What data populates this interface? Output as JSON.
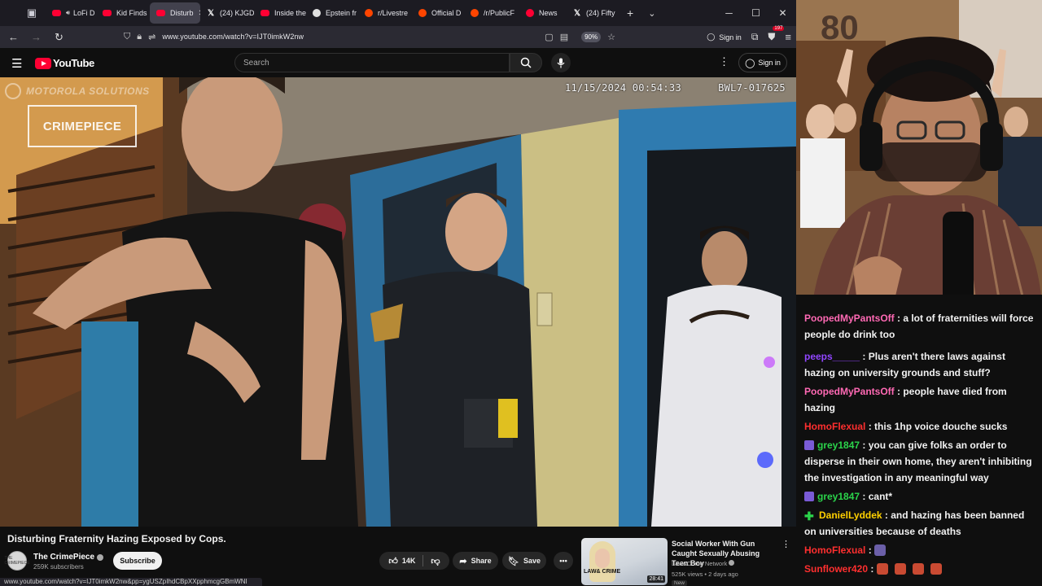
{
  "browser": {
    "tabs": [
      {
        "label": "LoFi D",
        "icon": "youtube",
        "audio": true,
        "active": false
      },
      {
        "label": "Kid Finds",
        "icon": "youtube",
        "active": false
      },
      {
        "label": "Disturb",
        "icon": "youtube",
        "active": true
      },
      {
        "label": "(24) KJGD",
        "icon": "x",
        "active": false
      },
      {
        "label": "Inside the",
        "icon": "youtube",
        "active": false
      },
      {
        "label": "Epstein fr",
        "icon": "epstein",
        "active": false
      },
      {
        "label": "r/Livestre",
        "icon": "reddit",
        "active": false
      },
      {
        "label": "Official D",
        "icon": "reddit",
        "active": false
      },
      {
        "label": "/r/PublicF",
        "icon": "reddit",
        "active": false
      },
      {
        "label": "News",
        "icon": "news",
        "active": false
      },
      {
        "label": "(24) Fifty",
        "icon": "x",
        "active": false
      }
    ],
    "url": "www.youtube.com/watch?v=IJT0imkW2nw",
    "zoom": "90%",
    "signin_label": "Sign in",
    "extension_badge_count": "197",
    "status_url": "www.youtube.com/watch?v=IJT0imkW2nw&pp=ygUSZpIhdCBpXXpphmcgGBmWNI"
  },
  "youtube": {
    "logo_text": "YouTube",
    "search_placeholder": "Search",
    "signin_label": "Sign in",
    "video": {
      "timestamp": "11/15/2024 00:54:33",
      "camera_id": "BWL7-017625",
      "watermark_brand": "MOTOROLA SOLUTIONS",
      "overlay_logo": "CRIMEPIECE",
      "title": "Disturbing Fraternity Hazing Exposed by Cops.",
      "channel_name": "The CrimePiece",
      "channel_avatar_text": "THE CRIMEPIECE",
      "subscribers": "259K subscribers",
      "subscribe_label": "Subscribe",
      "likes": "14K",
      "share_label": "Share",
      "save_label": "Save"
    },
    "recommendation": {
      "title": "Social Worker With Gun Caught Sexually Abusing Teen Boy",
      "channel": "Law&Crime Network",
      "meta": "525K views • 2 days ago",
      "badge": "New",
      "duration": "28:41",
      "thumb_text": "LAW& CRIME"
    }
  },
  "chat": {
    "messages": [
      {
        "user": "PoopedMyPantsOff",
        "color": "#ff69b4",
        "text": "a lot of fraternities will force people do drink too"
      },
      {
        "user": "peeps_____",
        "color": "#9146ff",
        "text": "Plus aren't there laws against hazing on university grounds and stuff?"
      },
      {
        "user": "PoopedMyPantsOff",
        "color": "#ff69b4",
        "text": "people have died from hazing"
      },
      {
        "user": "HomoFlexual",
        "color": "#ff2f2f",
        "text": "this 1hp voice douche sucks"
      },
      {
        "user": "grey1847",
        "color": "#2bd44b",
        "badge": "sub",
        "text": "you can give folks an order to disperse in their own home, they aren't inhibiting the investigation in any meaningful way"
      },
      {
        "user": "grey1847",
        "color": "#2bd44b",
        "badge": "sub",
        "text": "cant*"
      },
      {
        "user": "DanielLyddek",
        "color": "#ffd000",
        "badge": "vip",
        "text": "and hazing has been banned on universities because of deaths"
      },
      {
        "user": "HomoFlexual",
        "color": "#ff2f2f",
        "text": "",
        "emote": "e1"
      },
      {
        "user": "Sunflower420",
        "color": "#ff2f2f",
        "text": "",
        "emote": "e2"
      }
    ]
  },
  "colors": {
    "yt_red": "#ff0033",
    "browser_tabbar": "#1c1b22",
    "browser_nav": "#2b2a33",
    "background": "#0f0f0f"
  }
}
